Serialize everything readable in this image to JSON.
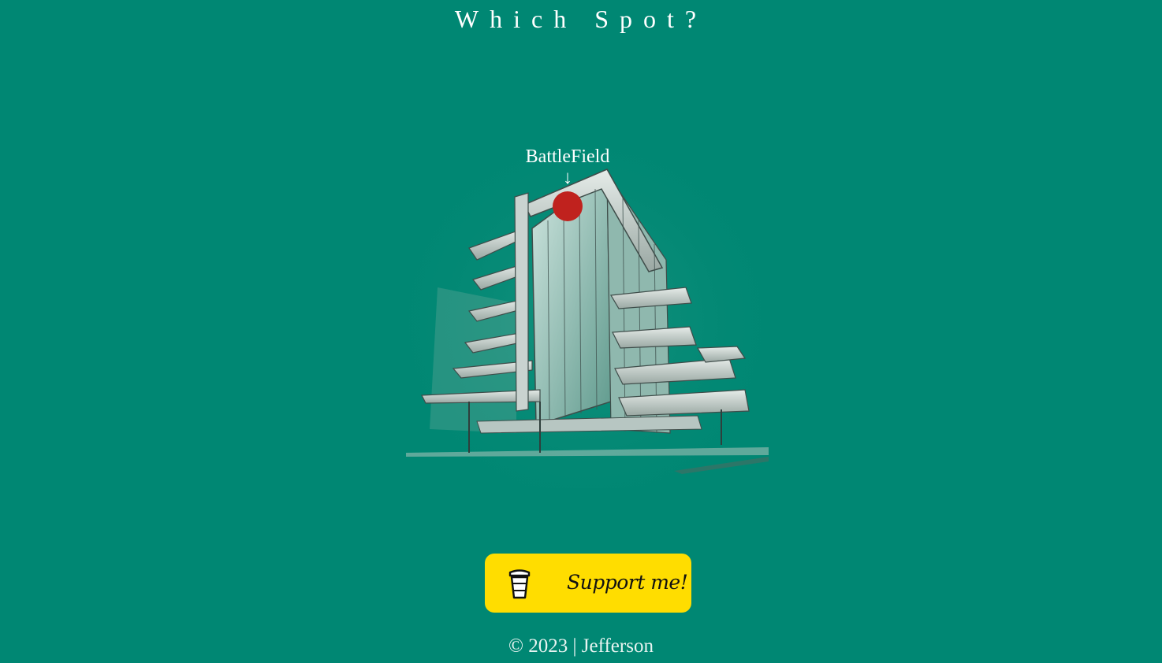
{
  "header": {
    "title": "Which Spot?"
  },
  "scene": {
    "image_icon": "building-sketch-illustration",
    "spot": {
      "label": "BattleField",
      "arrow": "↓",
      "marker_color": "#c0221e"
    }
  },
  "support": {
    "label": "Support me!",
    "icon": "coffee-cup-icon",
    "color": "#ffdd00"
  },
  "footer": {
    "text": "© 2023 | Jefferson"
  },
  "theme": {
    "background": "#008773"
  }
}
